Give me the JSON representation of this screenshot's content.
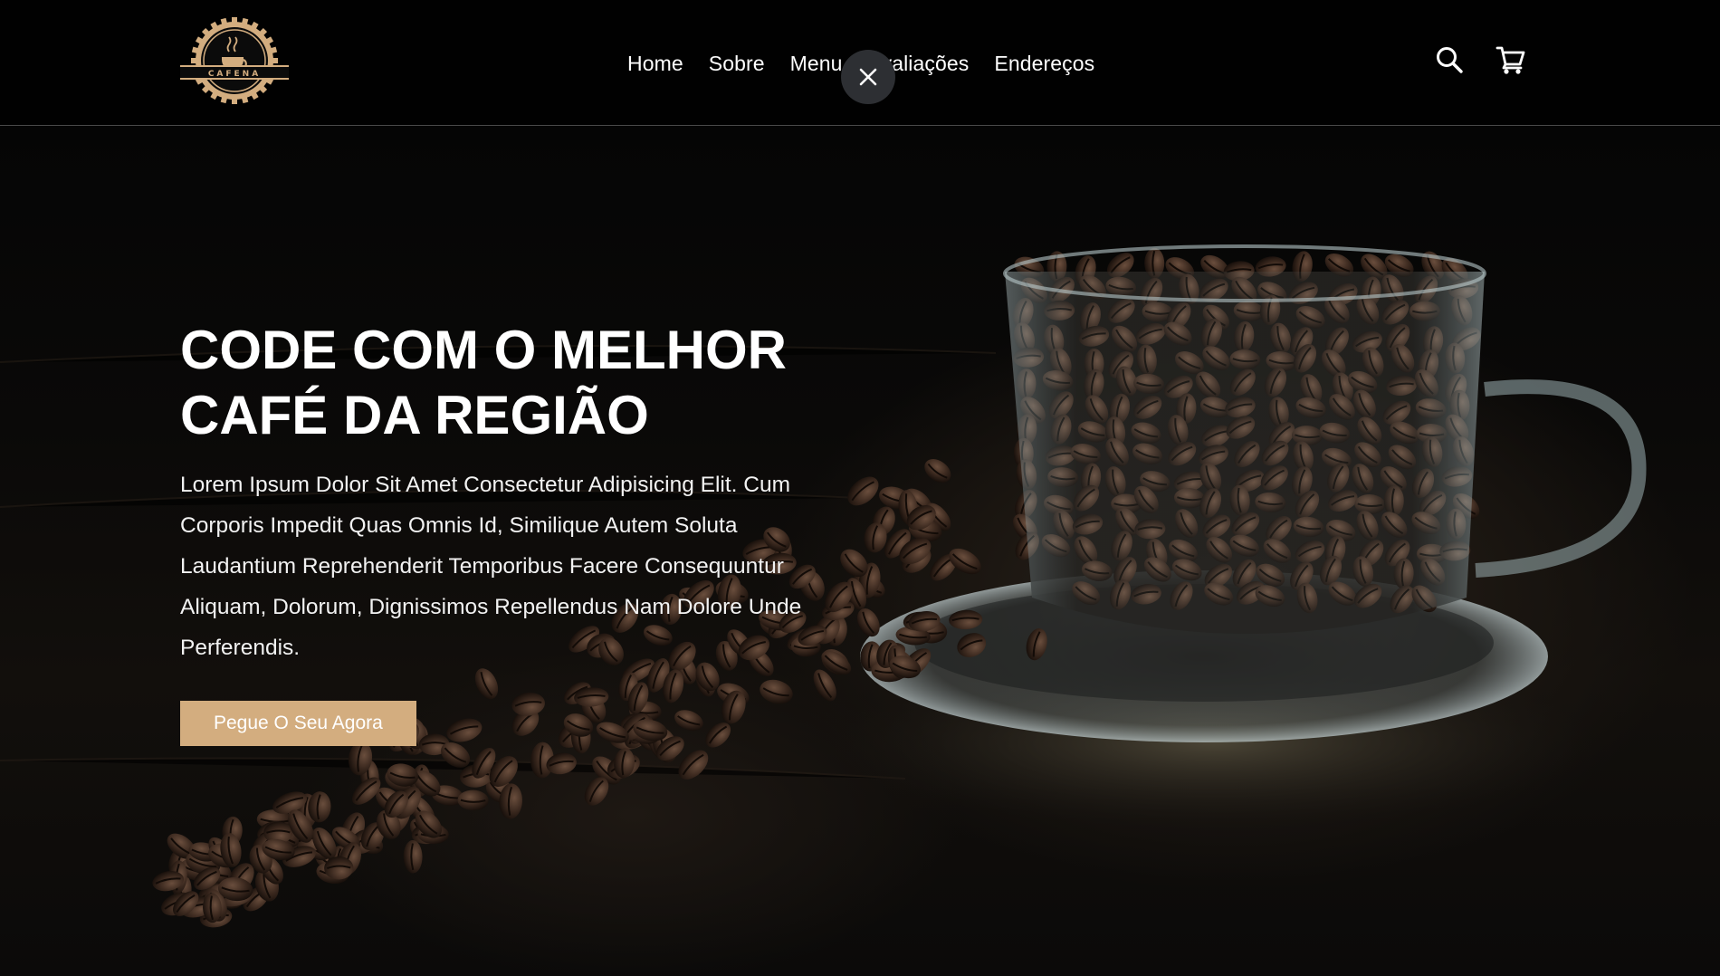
{
  "brand": {
    "logo_text": "CAFENA"
  },
  "nav": {
    "items": [
      {
        "label": "Home"
      },
      {
        "label": "Sobre"
      },
      {
        "label": "Menu"
      },
      {
        "label": "Avaliações"
      },
      {
        "label": "Endereços"
      }
    ]
  },
  "header": {
    "close_icon": "close-icon",
    "search_icon": "search-icon",
    "cart_icon": "cart-icon"
  },
  "hero": {
    "title_line1": "CODE COM O MELHOR",
    "title_line2": "CAFÉ DA REGIÃO",
    "description": "Lorem Ipsum Dolor Sit Amet Consectetur Adipisicing Elit. Cum Corporis Impedit Quas Omnis Id, Similique Autem Soluta Laudantium Reprehenderit Temporibus Facere Consequuntur Aliquam, Dolorum, Dignissimos Repellendus Nam Dolore Unde Perferendis.",
    "cta_label": "Pegue O Seu Agora"
  },
  "colors": {
    "accent": "#d3ad7f",
    "header_bg": "#010101",
    "text": "#ffffff"
  }
}
